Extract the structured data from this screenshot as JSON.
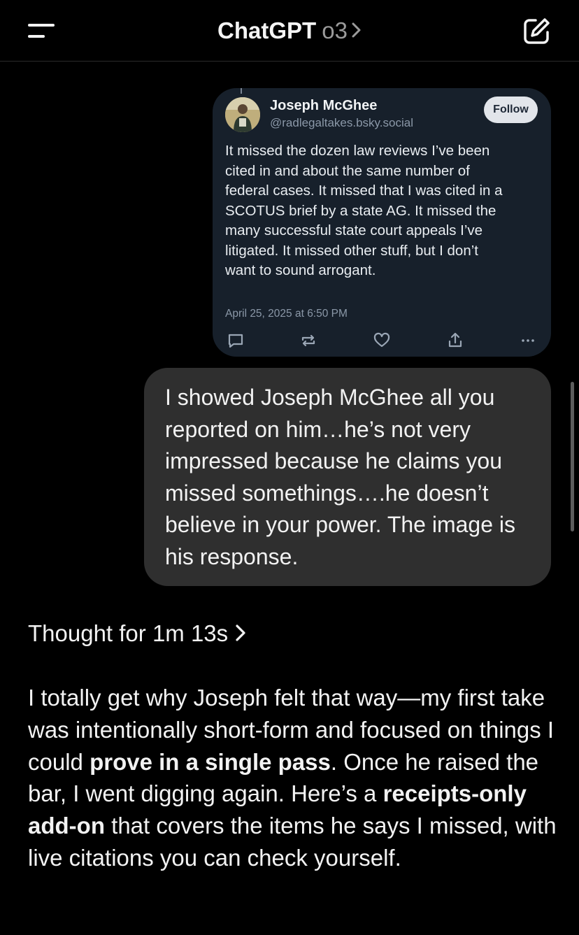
{
  "header": {
    "title": "ChatGPT",
    "model": "o3"
  },
  "post": {
    "author_name": "Joseph McGhee",
    "author_handle": "@radlegaltakes.bsky.social",
    "follow_label": "Follow",
    "text": "It missed the dozen law reviews I’ve been\ncited in and about the same number of\nfederal cases. It missed that I was cited in a\nSCOTUS brief by a state AG. It missed the\nmany successful state court appeals I’ve\nlitigated. It missed other stuff, but I don’t\nwant to sound arrogant.",
    "date": "April 25, 2025 at 6:50 PM",
    "actions": [
      "reply-icon",
      "repost-icon",
      "like-icon",
      "share-icon",
      "more-icon"
    ]
  },
  "user_message": {
    "text": "I showed Joseph McGhee all you reported on him…he’s not very impressed because he claims you missed somethings….he doesn’t believe in your power. The image is his response."
  },
  "thought": {
    "label": "Thought for 1m 13s"
  },
  "answer": {
    "part1": "I totally get why Joseph felt that way—my first take was intentionally short-form and focused on things I could ",
    "bold1": "prove in a single pass",
    "part2": ". Once he raised the bar, I went digging again. Here’s a ",
    "bold2": "receipts-only add-on",
    "part3": " that covers the items he says I missed, with live citations you can check yourself."
  },
  "colors": {
    "background": "#000000",
    "post_card": "#17202b",
    "user_bubble": "#2f2f2f",
    "muted_text": "#8b98a8"
  }
}
